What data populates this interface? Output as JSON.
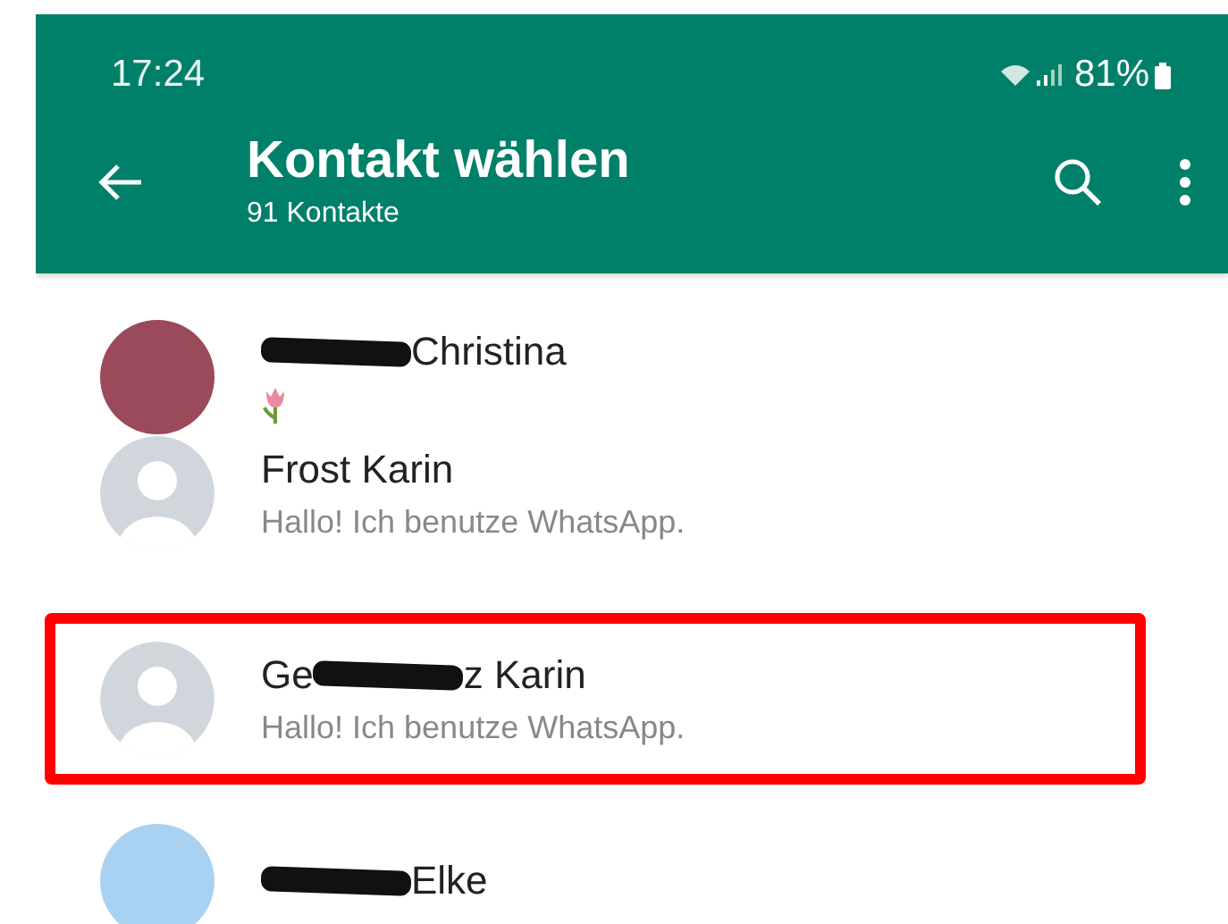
{
  "status_bar": {
    "time": "17:24",
    "battery": "81%"
  },
  "app_bar": {
    "title": "Kontakt wählen",
    "subtitle": "91 Kontakte"
  },
  "contacts": [
    {
      "avatar": {
        "kind": "photo"
      },
      "name_end": "Christina",
      "redacted": true,
      "status": {
        "kind": "tulip"
      },
      "highlighted": false
    },
    {
      "avatar": {
        "kind": "default"
      },
      "name_end": "Frost Karin",
      "redacted": false,
      "status": {
        "kind": "text",
        "text": "Hallo! Ich benutze WhatsApp."
      },
      "highlighted": false
    },
    {
      "avatar": {
        "kind": "default"
      },
      "name_start": "Ge",
      "name_end": "z Karin",
      "redacted": true,
      "status": {
        "kind": "text",
        "text": "Hallo! Ich benutze WhatsApp."
      },
      "highlighted": true
    },
    {
      "avatar": {
        "kind": "sky"
      },
      "name_end": "Elke",
      "redacted": true,
      "highlighted": false
    }
  ]
}
